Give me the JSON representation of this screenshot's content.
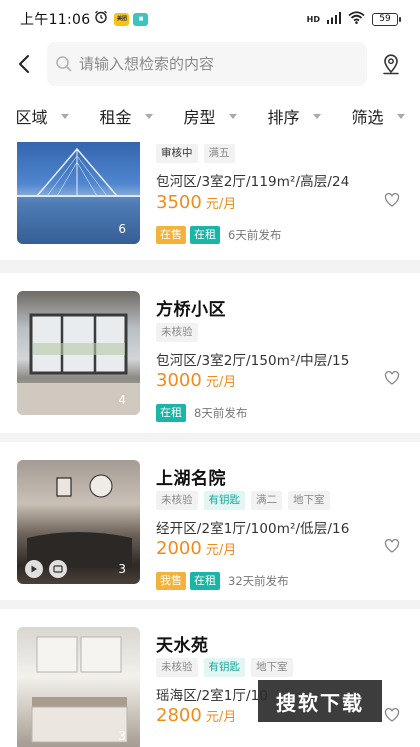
{
  "status_bar": {
    "time": "上午11:06",
    "battery": "59",
    "signal_text": "HD"
  },
  "search": {
    "placeholder": "请输入想检索的内容"
  },
  "filters": [
    "区域",
    "租金",
    "房型",
    "排序",
    "筛选"
  ],
  "listings": [
    {
      "title": "",
      "tags": [
        {
          "text": "审核中",
          "style": "dark"
        },
        {
          "text": "满五",
          "style": "plain"
        }
      ],
      "desc": "包河区/3室2厅/119m²/高层/24",
      "price": "3500",
      "unit": "元/月",
      "photo_count": "6",
      "badges": [
        {
          "text": "在售",
          "style": "sale"
        },
        {
          "text": "在租",
          "style": "rent"
        }
      ],
      "posted": "6天前发布"
    },
    {
      "title": "方桥小区",
      "tags": [
        {
          "text": "未核验",
          "style": "plain"
        }
      ],
      "desc": "包河区/3室2厅/150m²/中层/15",
      "price": "3000",
      "unit": "元/月",
      "photo_count": "4",
      "badges": [
        {
          "text": "在租",
          "style": "rent"
        }
      ],
      "posted": "8天前发布"
    },
    {
      "title": "上湖名院",
      "tags": [
        {
          "text": "未核验",
          "style": "plain"
        },
        {
          "text": "有钥匙",
          "style": "key"
        },
        {
          "text": "满二",
          "style": "plain"
        },
        {
          "text": "地下室",
          "style": "plain"
        }
      ],
      "desc": "经开区/2室1厅/100m²/低层/16",
      "price": "2000",
      "unit": "元/月",
      "photo_count": "3",
      "badges": [
        {
          "text": "我售",
          "style": "sale"
        },
        {
          "text": "在租",
          "style": "rent"
        }
      ],
      "posted": "32天前发布"
    },
    {
      "title": "天水苑",
      "tags": [
        {
          "text": "未核验",
          "style": "plain"
        },
        {
          "text": "有钥匙",
          "style": "key"
        },
        {
          "text": "地下室",
          "style": "plain"
        }
      ],
      "desc": "瑶海区/2室1厅/10",
      "price": "2800",
      "unit": "元/月",
      "photo_count": "3",
      "badges": [],
      "posted": ""
    }
  ],
  "watermark": "搜软下载",
  "colors": {
    "accent_price": "#f08c1a",
    "rent_badge": "#1ab5a6",
    "sale_badge": "#f3b23a"
  }
}
